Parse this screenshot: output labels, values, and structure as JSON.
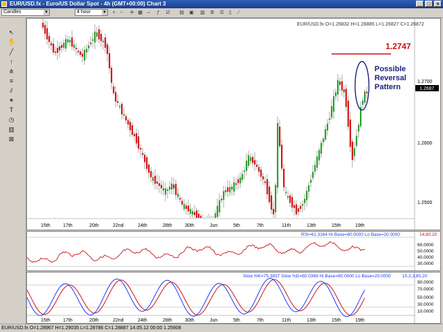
{
  "window": {
    "title": "EUR/USD.fx - Euro/US Dollar Spot - 4h (GMT+00:00)   Chart 3"
  },
  "toolbar": {
    "chart_type": "Candles",
    "timeframe": "4 hour"
  },
  "chart": {
    "ohlc_label": "EUR/USD.fx O=1.26832 H=1.26885 L=1.26827 C=1.26872",
    "annotation_level": "1.2747",
    "annotation_text": [
      "Possible",
      "Reversal",
      "Pattern"
    ],
    "price_ticks": [
      "1.2700",
      "1.2600",
      "1.2500"
    ],
    "current_price": "1.2687",
    "dates": [
      "15th",
      "17th",
      "20th",
      "22nd",
      "24th",
      "28th",
      "30th",
      "Jun",
      "5th",
      "7th",
      "11th",
      "13th",
      "15th",
      "19th"
    ]
  },
  "rsi": {
    "label": "RSI=61.3164 Hi Base=80.0000 Lo Base=20.0000",
    "params": "14,80,20",
    "ticks": [
      "60.0000",
      "50.0000",
      "40.0000",
      "30.0000"
    ]
  },
  "stoch": {
    "label": "Slow %K=75.3837 Slow %D=60.0369 Hi Base=80.0000 Lo Base=20.0000",
    "params": "10,3,3,80,20",
    "ticks": [
      "90.0000",
      "70.0000",
      "50.0000",
      "30.0000",
      "10.0000"
    ]
  },
  "status": {
    "text": "EUR/USD.fx O=1.28967 H=1.29035 L=1.28786 C=1.28887   14.05.12 00:00  1.25908"
  },
  "colors": {
    "up": "#2e9e2e",
    "down": "#d01818",
    "annotation_red": "#cc1111",
    "annotation_blue": "#1a237e",
    "rsi_line": "#cc1111",
    "stoch_k": "#1a3cff",
    "stoch_d": "#cc1111"
  }
}
